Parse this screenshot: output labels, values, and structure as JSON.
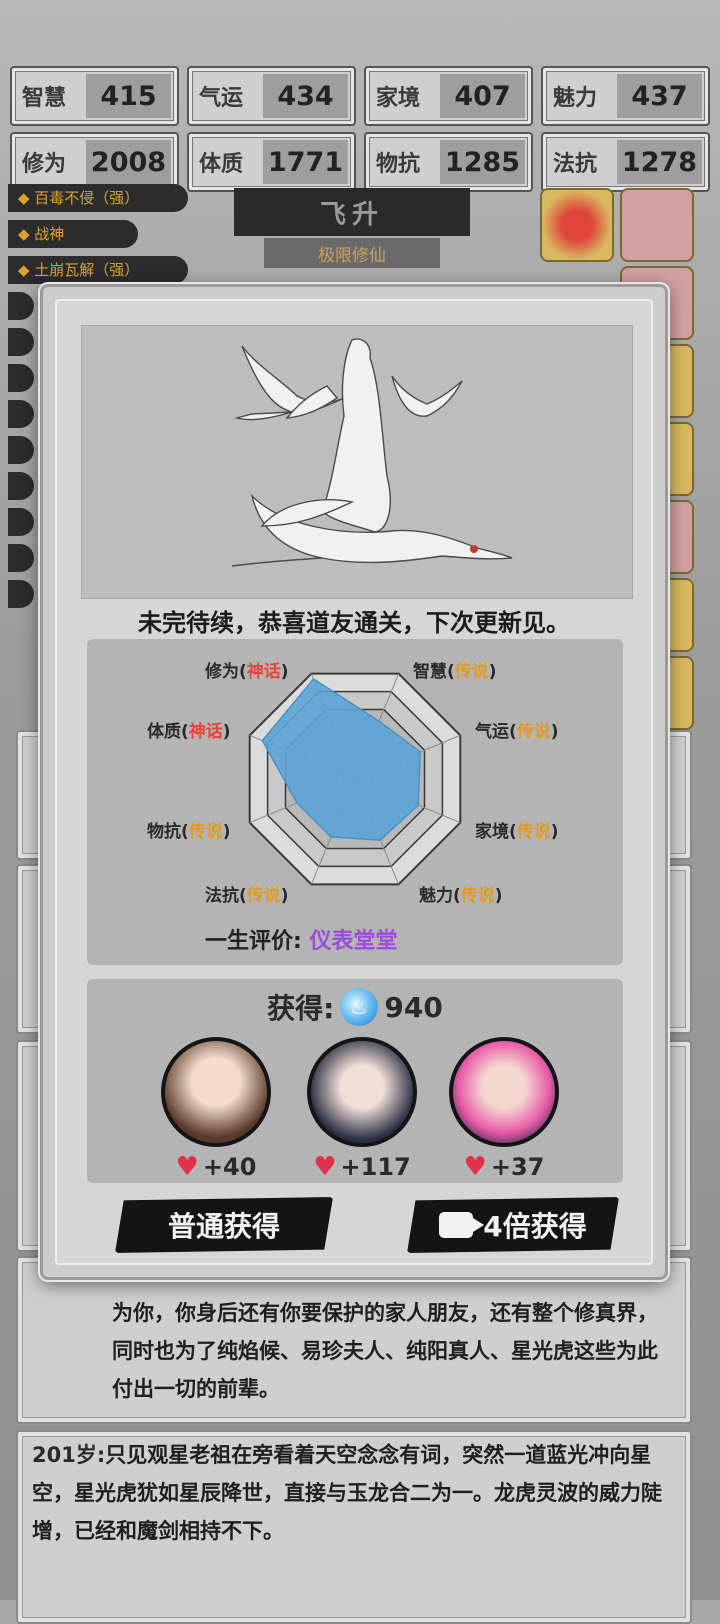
{
  "stats": [
    {
      "name": "智慧",
      "value": "415"
    },
    {
      "name": "气运",
      "value": "434"
    },
    {
      "name": "家境",
      "value": "407"
    },
    {
      "name": "魅力",
      "value": "437"
    },
    {
      "name": "修为",
      "value": "2008"
    },
    {
      "name": "体质",
      "value": "1771"
    },
    {
      "name": "物抗",
      "value": "1285"
    },
    {
      "name": "法抗",
      "value": "1278"
    }
  ],
  "left_tags": [
    "◆ 百毒不侵（强）",
    "◆ 战神",
    "◆ 土崩瓦解（强）"
  ],
  "stage": {
    "title": "飞升",
    "subtitle": "极限修仙"
  },
  "modal": {
    "headline": "未完待续，恭喜道友通关，下次更新见。",
    "radar_labels": [
      {
        "name": "修为",
        "quality": "神话",
        "tier": "myth"
      },
      {
        "name": "智慧",
        "quality": "传说",
        "tier": "legend"
      },
      {
        "name": "气运",
        "quality": "传说",
        "tier": "legend"
      },
      {
        "name": "家境",
        "quality": "传说",
        "tier": "legend"
      },
      {
        "name": "魅力",
        "quality": "传说",
        "tier": "legend"
      },
      {
        "name": "法抗",
        "quality": "传说",
        "tier": "legend"
      },
      {
        "name": "物抗",
        "quality": "传说",
        "tier": "legend"
      },
      {
        "name": "体质",
        "quality": "神话",
        "tier": "myth"
      }
    ],
    "radar_levels": [
      0.95,
      0.55,
      0.62,
      0.6,
      0.58,
      0.55,
      0.55,
      0.88
    ],
    "evaluation_label": "一生评价:",
    "evaluation_value": "仪表堂堂",
    "reward_label": "获得:",
    "reward_amount": "940",
    "characters": [
      {
        "affection": "+40"
      },
      {
        "affection": "+117"
      },
      {
        "affection": "+37"
      }
    ],
    "normal_button": "普通获得",
    "video_button": "4倍获得"
  },
  "log": [
    {
      "age": "",
      "text": "为你，你身后还有你要保护的家人朋友，还有整个修真界，同时也为了纯焰候、易珍夫人、纯阳真人、星光虎这些为此付出一切的前辈。"
    },
    {
      "age": "201岁:",
      "text": "只见观星老祖在旁看着天空念念有词，突然一道蓝光冲向星空，星光虎犹如星辰降世，直接与玉龙合二为一。龙虎灵波的威力陡增，已经和魔剑相持不下。"
    }
  ],
  "colors": {
    "myth": "#e8453a",
    "legend": "#e39a20",
    "evaluation": "#9b4be0",
    "radar_fill": "#5ba3d6"
  }
}
